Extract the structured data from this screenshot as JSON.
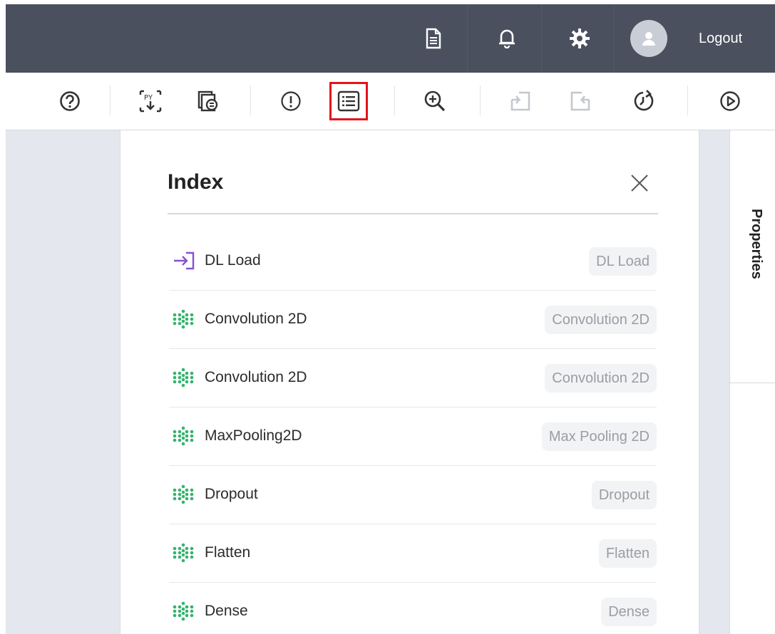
{
  "header": {
    "logout_label": "Logout",
    "icons": [
      "document-icon",
      "bell-icon",
      "gear-icon",
      "user-avatar-icon"
    ]
  },
  "toolbar": {
    "tools": [
      "help-icon",
      "python-export-icon",
      "model-summary-icon",
      "warning-icon",
      "index-list-icon",
      "zoom-in-icon",
      "undo-icon",
      "redo-icon",
      "history-icon",
      "run-icon"
    ],
    "active_tool": "index-list-icon"
  },
  "index_panel": {
    "title": "Index",
    "items": [
      {
        "name": "DL Load",
        "tag": "DL Load",
        "icon": "load-icon"
      },
      {
        "name": "Convolution 2D",
        "tag": "Convolution 2D",
        "icon": "layer-icon"
      },
      {
        "name": "Convolution 2D",
        "tag": "Convolution 2D",
        "icon": "layer-icon"
      },
      {
        "name": "MaxPooling2D",
        "tag": "Max Pooling 2D",
        "icon": "layer-icon"
      },
      {
        "name": "Dropout",
        "tag": "Dropout",
        "icon": "layer-icon"
      },
      {
        "name": "Flatten",
        "tag": "Flatten",
        "icon": "layer-icon"
      },
      {
        "name": "Dense",
        "tag": "Dense",
        "icon": "layer-icon"
      }
    ]
  },
  "right_panel": {
    "tab_label": "Properties"
  },
  "colors": {
    "header_bg": "#4a505e",
    "workspace_bg": "#e4e7ee",
    "active_outline": "#e3131b",
    "load_icon": "#8a4fd3",
    "layer_icon": "#35b36d"
  }
}
